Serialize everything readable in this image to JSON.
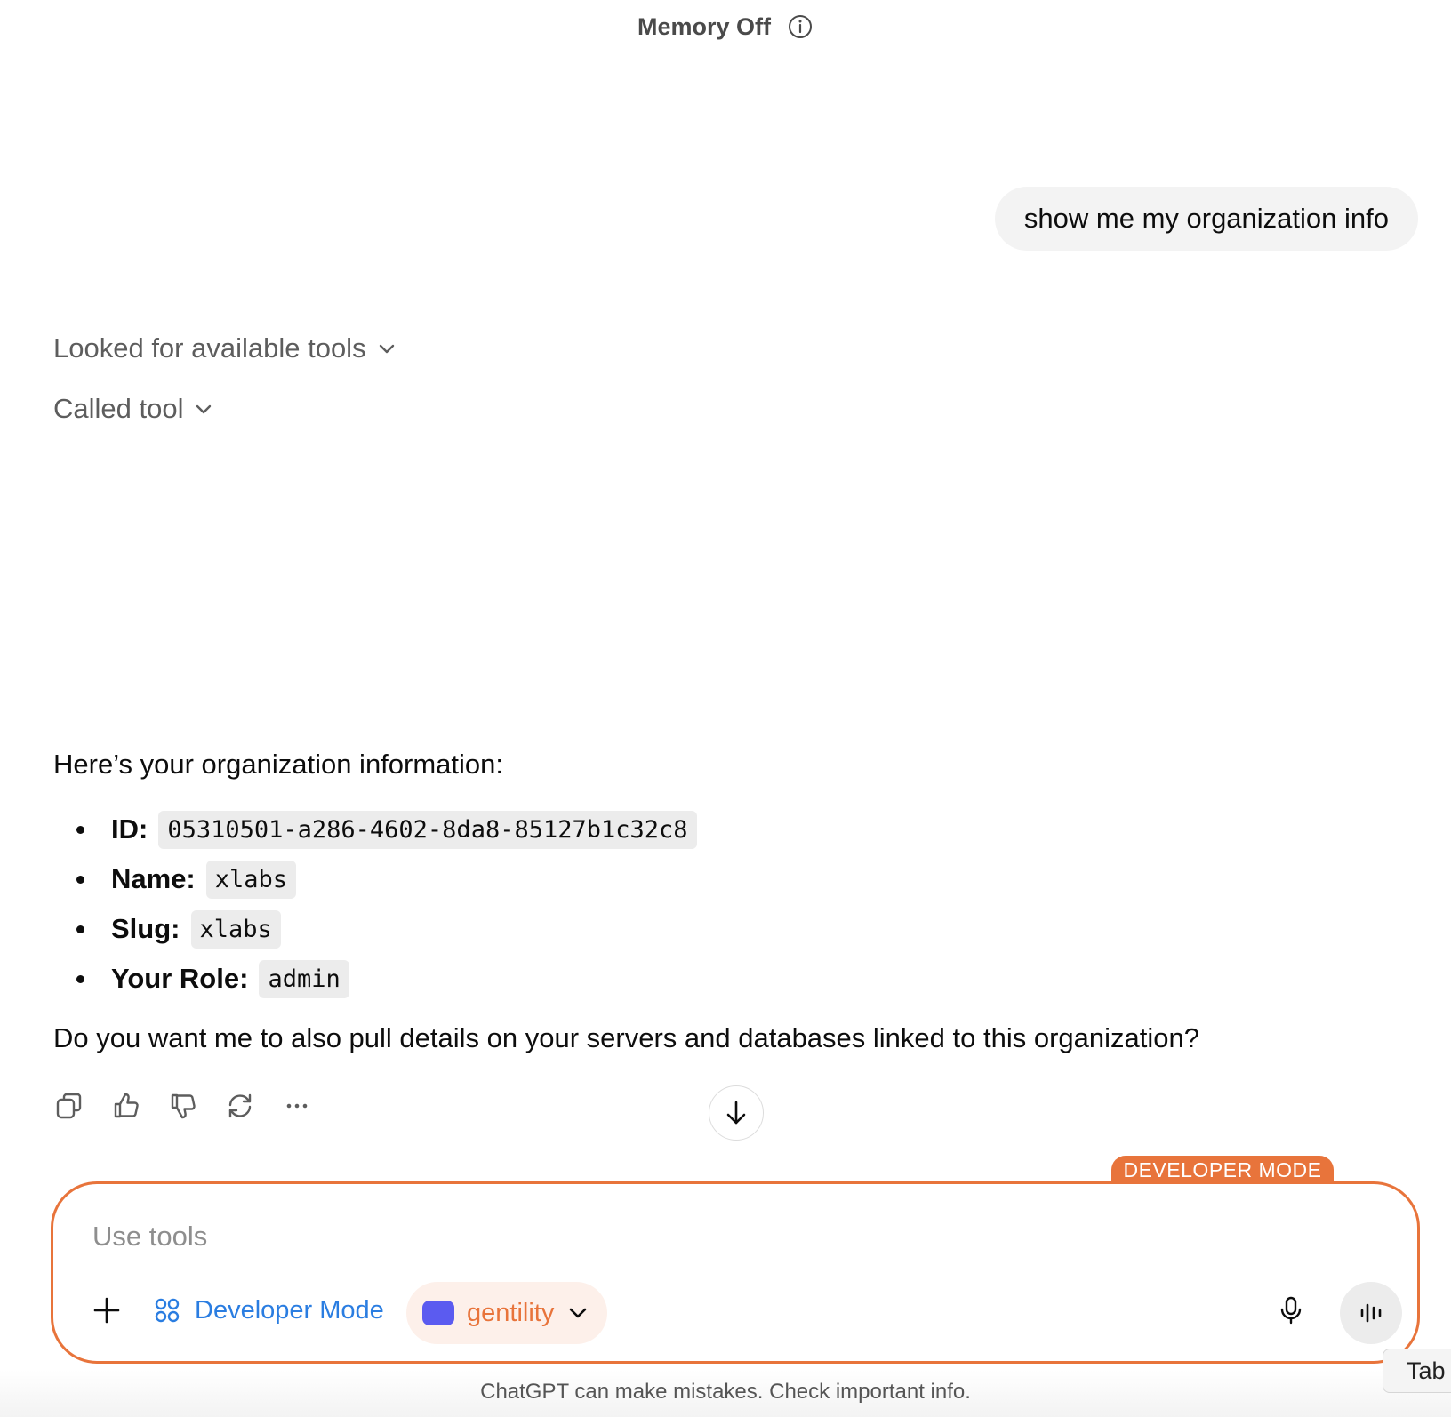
{
  "header": {
    "title": "Memory Off",
    "info_icon": "info-circle-icon"
  },
  "conversation": {
    "user_message": "show me my organization info",
    "tool_steps": [
      {
        "label": "Looked for available tools"
      },
      {
        "label": "Called tool"
      }
    ],
    "assistant": {
      "intro": "Here’s your organization information:",
      "fields": [
        {
          "label": "ID:",
          "value": "05310501-a286-4602-8da8-85127b1c32c8"
        },
        {
          "label": "Name:",
          "value": "xlabs"
        },
        {
          "label": "Slug:",
          "value": "xlabs"
        },
        {
          "label": "Your Role:",
          "value": "admin"
        }
      ],
      "question": "Do you want me to also pull details on your servers and databases linked to this organization?"
    },
    "actions": [
      "copy-icon",
      "thumbs-up-icon",
      "thumbs-down-icon",
      "regenerate-icon",
      "more-icon"
    ]
  },
  "composer": {
    "mode_tab": "DEVELOPER MODE",
    "placeholder": "Use tools",
    "developer_mode_label": "Developer Mode",
    "connector_label": "gentility",
    "colors": {
      "accent": "#e8743b",
      "link": "#2a7de1",
      "connector_swatch": "#5b5bf0"
    }
  },
  "footer": {
    "disclaimer": "ChatGPT can make mistakes. Check important info.",
    "tab_hint": "Tab"
  }
}
